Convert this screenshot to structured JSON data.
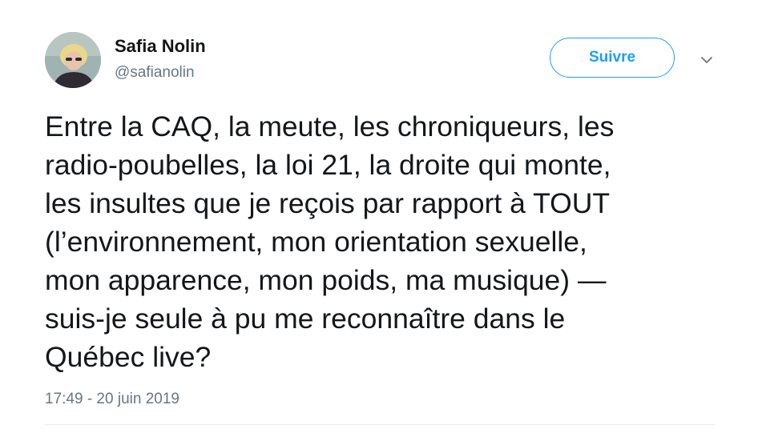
{
  "tweet": {
    "author": {
      "name": "Safia Nolin",
      "handle": "@safianolin",
      "avatar_icon": "profile-photo"
    },
    "follow_button_label": "Suivre",
    "menu_icon": "chevron-down-icon",
    "text": "Entre la CAQ, la meute, les chroniqueurs, les\nradio-poubelles, la loi 21, la droite qui monte,\nles insultes que je reçois par rapport à TOUT\n(l’environnement, mon orientation sexuelle,\nmon apparence, mon poids, ma musique) —\nsuis-je seule à pu me reconnaître dans le\nQuébec live?",
    "timestamp": "17:49 - 20 juin 2019"
  },
  "colors": {
    "accent": "#1da1f2",
    "text_primary": "#14171a",
    "text_secondary": "#657786",
    "divider": "#e6ecf0"
  }
}
